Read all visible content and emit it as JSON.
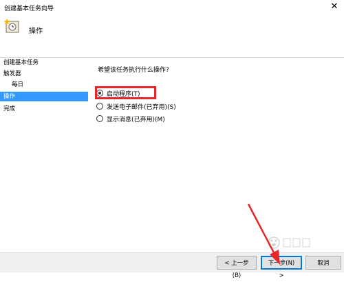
{
  "window": {
    "title": "创建基本任务向导",
    "close_glyph": "✕"
  },
  "header": {
    "title": "操作",
    "icon": "task-wizard-icon"
  },
  "sidebar": {
    "items": [
      {
        "label": "创建基本任务"
      },
      {
        "label": "触发器"
      },
      {
        "label": "每日"
      },
      {
        "label": "操作"
      },
      {
        "label": "完成"
      }
    ],
    "active_index": 3
  },
  "main": {
    "question": "希望该任务执行什么操作?",
    "options": [
      {
        "label": "启动程序(T)",
        "checked": true
      },
      {
        "label": "发送电子邮件(已弃用)(S)",
        "checked": false
      },
      {
        "label": "显示消息(已弃用)(M)",
        "checked": false
      }
    ]
  },
  "footer": {
    "back_label": "< 上一步(B)",
    "next_label": "下一步(N) >",
    "cancel_label": "取消"
  },
  "annotation": {
    "highlight_color": "#e8262a",
    "arrow_color": "#e8262a"
  }
}
